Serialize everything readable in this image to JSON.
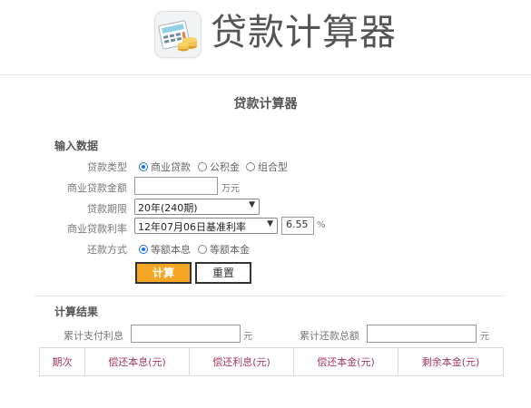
{
  "header": {
    "title": "贷款计算器",
    "icon": "calculator-icon"
  },
  "section_title": "贷款计算器",
  "input_group": {
    "title": "输入数据",
    "loan_type": {
      "label": "贷款类型",
      "options": [
        "商业贷款",
        "公积金",
        "组合型"
      ],
      "selected": "商业贷款"
    },
    "amount": {
      "label": "商业贷款金额",
      "value": "",
      "unit": "万元"
    },
    "term": {
      "label": "贷款期限",
      "selected": "20年(240期)"
    },
    "rate": {
      "label": "商业贷款利率",
      "selected": "12年07月06日基准利率",
      "value": "6.55",
      "unit": "%"
    },
    "method": {
      "label": "还款方式",
      "options": [
        "等额本息",
        "等额本金"
      ],
      "selected": "等额本息"
    },
    "calc_button": "计算",
    "reset_button": "重置"
  },
  "result_group": {
    "title": "计算结果",
    "total_interest": {
      "label": "累计支付利息",
      "value": "",
      "unit": "元"
    },
    "total_payment": {
      "label": "累计还款总额",
      "value": "",
      "unit": "元"
    },
    "table_headers": [
      "期次",
      "偿还本息(元)",
      "偿还利息(元)",
      "偿还本金(元)",
      "剩余本金(元)"
    ]
  },
  "colors": {
    "accent_button": "#f6a623",
    "radio_checked": "#1a73e8",
    "table_header_text": "#a33a5a"
  }
}
